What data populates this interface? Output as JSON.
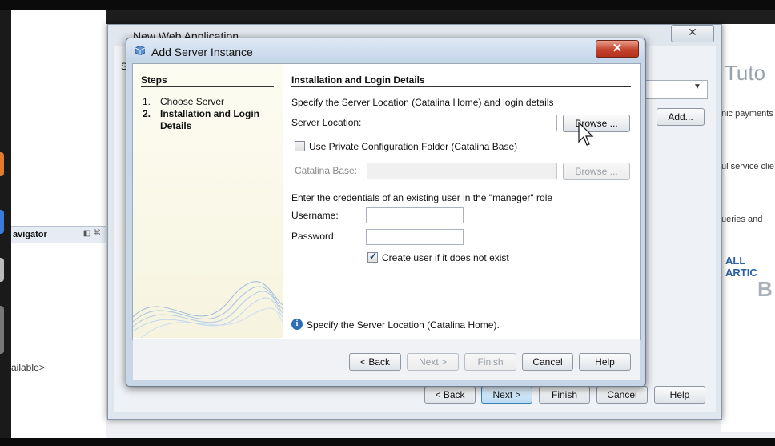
{
  "background": {
    "left_panel": {
      "navigator_label": "avigator",
      "navigator_icons": "◧ ⌘",
      "available_text": "ailable>"
    },
    "web_page": {
      "logo_text": "Tuto",
      "snippet_1": "nic payments",
      "snippet_2": "ul service clie",
      "snippet_3": "ueries and",
      "all_articles": "ALL ARTIC",
      "big_letter": "B"
    }
  },
  "back_dialog": {
    "title": "New Web Application",
    "close_label": "✕",
    "side_text": "S",
    "add_label": "Add...",
    "buttons": {
      "back": "< Back",
      "next": "Next >",
      "finish": "Finish",
      "cancel": "Cancel",
      "help": "Help"
    }
  },
  "dialog": {
    "title": "Add Server Instance",
    "close_label": "✕",
    "steps": {
      "title": "Steps",
      "items": [
        {
          "num": "1.",
          "label": "Choose Server"
        },
        {
          "num": "2.",
          "label": "Installation and Login Details"
        }
      ]
    },
    "content": {
      "title": "Installation and Login Details",
      "description": "Specify the Server Location (Catalina Home) and login details",
      "server_location_label": "Server Location:",
      "server_location_value": "",
      "browse_label": "Browse ...",
      "private_config_label": "Use Private Configuration Folder (Catalina Base)",
      "private_config_checked": false,
      "catalina_base_label": "Catalina Base:",
      "catalina_base_value": "",
      "browse2_label": "Browse ...",
      "credentials_text": "Enter the credentials of an existing user in the \"manager\" role",
      "username_label": "Username:",
      "username_value": "",
      "password_label": "Password:",
      "password_value": "",
      "create_user_label": "Create user if it does not exist",
      "create_user_checked": true,
      "hint_icon": "info-icon",
      "hint_text": "Specify the Server Location (Catalina Home)."
    },
    "buttons": {
      "back": "< Back",
      "next": "Next >",
      "finish": "Finish",
      "cancel": "Cancel",
      "help": "Help"
    }
  },
  "colors": {
    "close_red": "#c4432b",
    "steps_bg": "#f6f4df",
    "info_blue": "#2d6db5",
    "accent_button": "#b9dbf4"
  }
}
